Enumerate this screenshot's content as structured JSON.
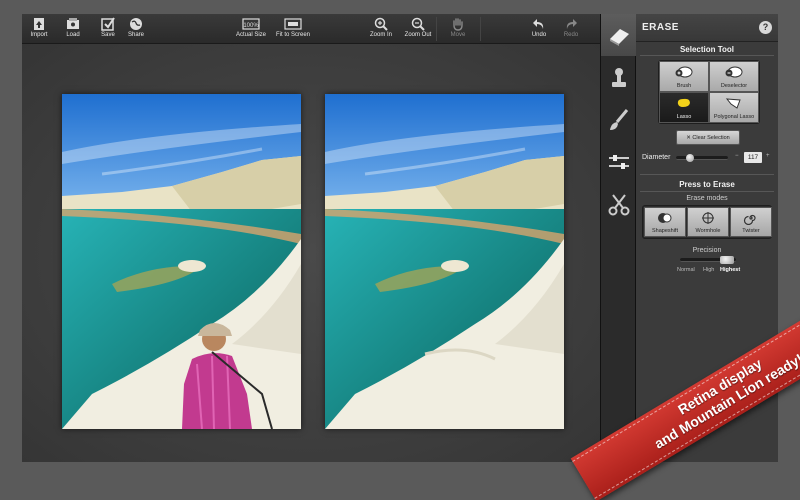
{
  "toolbar": {
    "import": "Import",
    "load": "Load",
    "save": "Save",
    "share": "Share",
    "actual_size_icon_text": "100%",
    "actual_size": "Actual Size",
    "fit_to_screen": "Fit to Screen",
    "zoom_in": "Zoom In",
    "zoom_out": "Zoom Out",
    "move": "Move",
    "undo": "Undo",
    "redo": "Redo"
  },
  "panel": {
    "title": "ERASE",
    "help": "?",
    "selection_tool_title": "Selection Tool",
    "tools": {
      "brush": "Brush",
      "deselector": "Deselector",
      "lasso": "Lasso",
      "polygonal_lasso": "Polygonal Lasso"
    },
    "clear_selection": "✕ Clear Selection",
    "diameter_label": "Diameter",
    "diameter_minus": "−",
    "diameter_plus": "+",
    "diameter_value": "117",
    "press_to_erase": "Press to Erase",
    "erase_modes_title": "Erase modes",
    "modes": {
      "shapeshift": "Shapeshift",
      "wormhole": "Wormhole",
      "twister": "Twister"
    },
    "precision_title": "Precision",
    "precision": {
      "normal": "Normal",
      "high": "High",
      "highest": "Highest",
      "selected": "Highest"
    }
  },
  "ribbon": {
    "line1": "Retina display",
    "line2": "and Mountain Lion ready!"
  },
  "colors": {
    "accent_lasso": "#f2d21a",
    "ribbon": "#c22e27"
  }
}
